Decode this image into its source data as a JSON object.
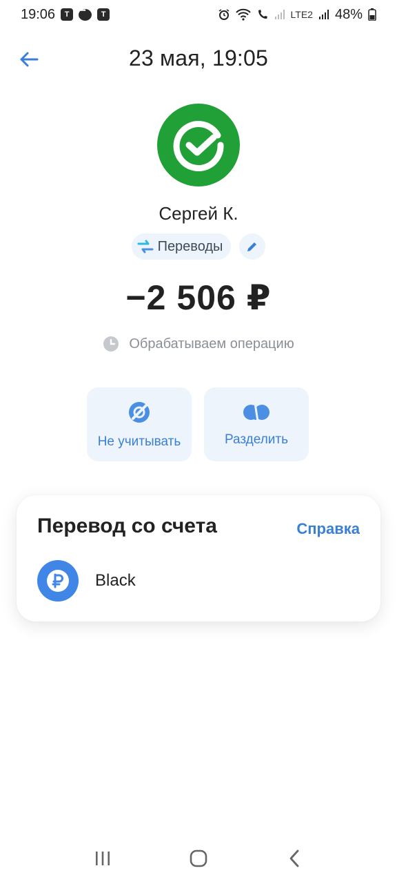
{
  "status_bar": {
    "time": "19:06",
    "battery": "48%",
    "network_label": "LTE2"
  },
  "header": {
    "title": "23 мая, 19:05",
    "back_icon": "arrow-left-icon"
  },
  "recipient": {
    "name": "Сергей К.",
    "avatar_icon": "sber-logo-icon",
    "avatar_color": "#21a038"
  },
  "category": {
    "label": "Переводы",
    "icon": "transfer-arrows-icon",
    "edit_icon": "pencil-icon"
  },
  "amount": "−2 506 ₽",
  "operation_status": {
    "text": "Обрабатываем операцию",
    "icon": "clock-icon"
  },
  "actions": [
    {
      "label": "Не учитывать",
      "icon": "exclude-icon"
    },
    {
      "label": "Разделить",
      "icon": "split-icon"
    }
  ],
  "source_card": {
    "title": "Перевод со счета",
    "help_link": "Справка",
    "account_name": "Black",
    "account_icon": "ruble-icon"
  },
  "colors": {
    "accent": "#3a7fd6",
    "chip_bg": "#eef4fb",
    "brand_green": "#21a038",
    "muted_text": "#8a8f96"
  }
}
